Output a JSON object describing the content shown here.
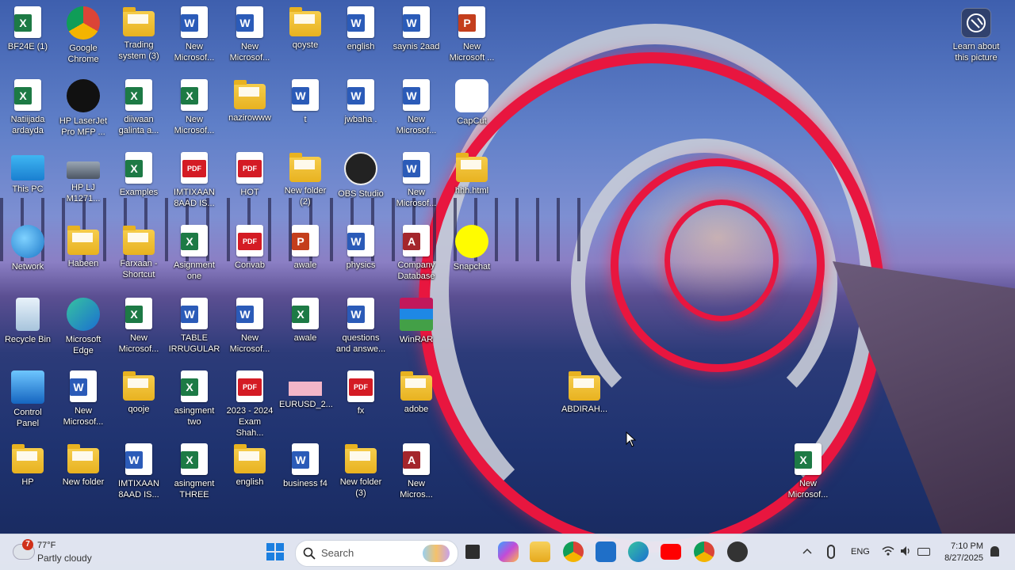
{
  "desktop": {
    "learn": {
      "label": "Learn about\nthis picture",
      "icon": "camera-circle-icon"
    },
    "icons": [
      {
        "label": "BF24E (1)",
        "type": "excel"
      },
      {
        "label": "Google\nChrome",
        "type": "chrome"
      },
      {
        "label": "Trading\nsystem (3)",
        "type": "folder"
      },
      {
        "label": "New\nMicrosof...",
        "type": "word"
      },
      {
        "label": "New\nMicrosof...",
        "type": "word"
      },
      {
        "label": "qoyste",
        "type": "folder"
      },
      {
        "label": "english",
        "type": "word"
      },
      {
        "label": "saynis 2aad",
        "type": "word"
      },
      {
        "label": "New\nMicrosoft ...",
        "type": "ppt"
      },
      {
        "label": "Natiijada\nardayda",
        "type": "excel"
      },
      {
        "label": "HP LaserJet\nPro MFP ...",
        "type": "hp"
      },
      {
        "label": "diiwaan\ngalinta a...",
        "type": "excel"
      },
      {
        "label": "New\nMicrosof...",
        "type": "excel"
      },
      {
        "label": "nazirowww",
        "type": "folder"
      },
      {
        "label": "t",
        "type": "word"
      },
      {
        "label": "jwbaha .",
        "type": "word"
      },
      {
        "label": "New\nMicrosof...",
        "type": "word"
      },
      {
        "label": "CapCut",
        "type": "capcut"
      },
      {
        "label": "This PC",
        "type": "pc"
      },
      {
        "label": "HP LJ\nM1271...",
        "type": "scanner"
      },
      {
        "label": "Examples",
        "type": "excel"
      },
      {
        "label": "IMTIXAAN\n8AAD IS...",
        "type": "pdf"
      },
      {
        "label": "HOT",
        "type": "pdf"
      },
      {
        "label": "New folder\n(2)",
        "type": "folder"
      },
      {
        "label": "OBS Studio",
        "type": "obs"
      },
      {
        "label": "New\nMicrosof...",
        "type": "word"
      },
      {
        "label": "hhh.html",
        "type": "folder"
      },
      {
        "label": "Network",
        "type": "network"
      },
      {
        "label": "Habeen",
        "type": "folder"
      },
      {
        "label": "Farxaan -\nShortcut",
        "type": "folder"
      },
      {
        "label": "Asignment\none",
        "type": "excel"
      },
      {
        "label": "Convab",
        "type": "pdf"
      },
      {
        "label": "awale",
        "type": "ppt"
      },
      {
        "label": "physics",
        "type": "word"
      },
      {
        "label": "Company\nDatabase",
        "type": "access"
      },
      {
        "label": "Snapchat",
        "type": "snapchat"
      },
      {
        "label": "Recycle Bin",
        "type": "recycle"
      },
      {
        "label": "Microsoft\nEdge",
        "type": "edge"
      },
      {
        "label": "New\nMicrosof...",
        "type": "excel"
      },
      {
        "label": "TABLE\nIRRUGULAR",
        "type": "word"
      },
      {
        "label": "New\nMicrosof...",
        "type": "word"
      },
      {
        "label": "awale",
        "type": "excel"
      },
      {
        "label": "questions\nand answe...",
        "type": "word"
      },
      {
        "label": "WinRAR",
        "type": "winrar"
      },
      {
        "label": "Control\nPanel",
        "type": "control"
      },
      {
        "label": "New\nMicrosof...",
        "type": "word"
      },
      {
        "label": "qooje",
        "type": "folder"
      },
      {
        "label": "asingment\ntwo",
        "type": "excel"
      },
      {
        "label": "2023 - 2024\nExam Shah...",
        "type": "pdf"
      },
      {
        "label": "EURUSD_2...",
        "type": "image"
      },
      {
        "label": "fx",
        "type": "pdf"
      },
      {
        "label": "adobe",
        "type": "folder"
      },
      {
        "label": "HP",
        "type": "folder"
      },
      {
        "label": "New folder",
        "type": "folder"
      },
      {
        "label": "IMTIXAAN\n8AAD IS...",
        "type": "word"
      },
      {
        "label": "asingment\nTHREE",
        "type": "excel"
      },
      {
        "label": "english",
        "type": "folder"
      },
      {
        "label": "business f4",
        "type": "word"
      },
      {
        "label": "New folder\n(3)",
        "type": "folder"
      },
      {
        "label": "New\nMicros...",
        "type": "access"
      },
      {
        "label": "ABDIRAH...",
        "type": "folder"
      },
      {
        "label": "New\nMicrosof...",
        "type": "excel"
      }
    ]
  },
  "taskbar": {
    "weather": {
      "badge": "7",
      "temp": "77°F",
      "desc": "Partly cloudy"
    },
    "search_placeholder": "Search",
    "tray": {
      "lang": "ENG",
      "time": "7:10 PM",
      "date": "8/27/2025"
    },
    "apps": [
      "windows-start-icon",
      "task-view-icon",
      "copilot-icon",
      "file-explorer-icon",
      "chrome-icon",
      "store-icon",
      "edge-icon",
      "youtube-icon",
      "chrome-profile-icon",
      "app-icon"
    ]
  }
}
